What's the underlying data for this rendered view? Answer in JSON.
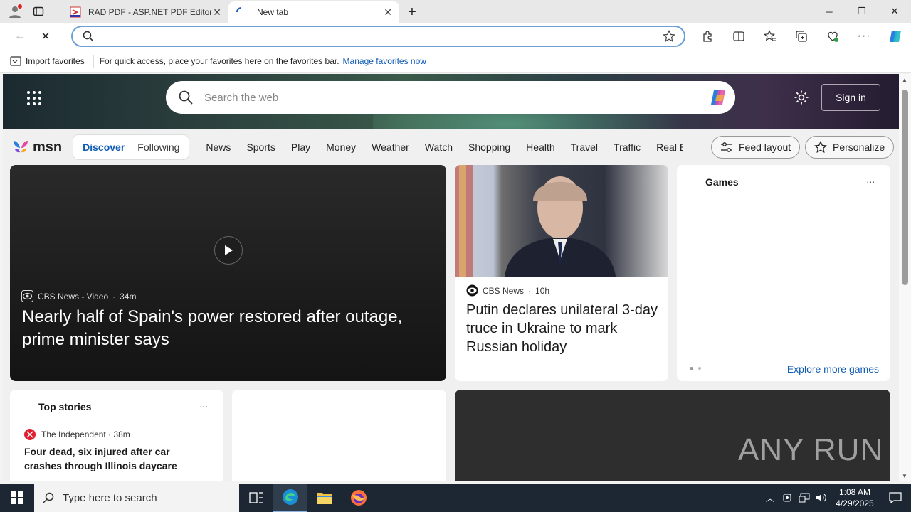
{
  "browser": {
    "tabs": [
      {
        "title": "RAD PDF - ASP.NET PDF Editor ar"
      },
      {
        "title": "New tab"
      }
    ],
    "address_placeholder": ""
  },
  "favorites_bar": {
    "import_label": "Import favorites",
    "message": "For quick access, place your favorites here on the favorites bar.",
    "link": "Manage favorites now"
  },
  "msn": {
    "search_placeholder": "Search the web",
    "signin": "Sign in",
    "logo_text": "msn",
    "pill": [
      "Discover",
      "Following"
    ],
    "categories": [
      "News",
      "Sports",
      "Play",
      "Money",
      "Weather",
      "Watch",
      "Shopping",
      "Health",
      "Travel",
      "Traffic",
      "Real E"
    ],
    "feed_layout": "Feed layout",
    "personalize": "Personalize"
  },
  "cards": {
    "big": {
      "source": "CBS News - Video",
      "age": "34m",
      "title": "Nearly half of Spain's power restored after outage, prime minister says"
    },
    "putin": {
      "source": "CBS News",
      "age": "10h",
      "title": "Putin declares unilateral 3-day truce in Ukraine to mark Russian holiday"
    },
    "games": {
      "title": "Games",
      "more": "...",
      "explore": "Explore more games"
    },
    "top_stories": {
      "title": "Top stories",
      "more": "...",
      "source": "The Independent",
      "age": "38m",
      "headline": "Four dead, six injured after car crashes through Illinois daycare"
    },
    "watermark": "ANY RUN"
  },
  "taskbar": {
    "search_placeholder": "Type here to search",
    "time": "1:08 AM",
    "date": "4/29/2025"
  },
  "colors": {
    "accent": "#0f5bb5",
    "taskbar": "#1c2733",
    "address_border": "#6a9fd8"
  }
}
